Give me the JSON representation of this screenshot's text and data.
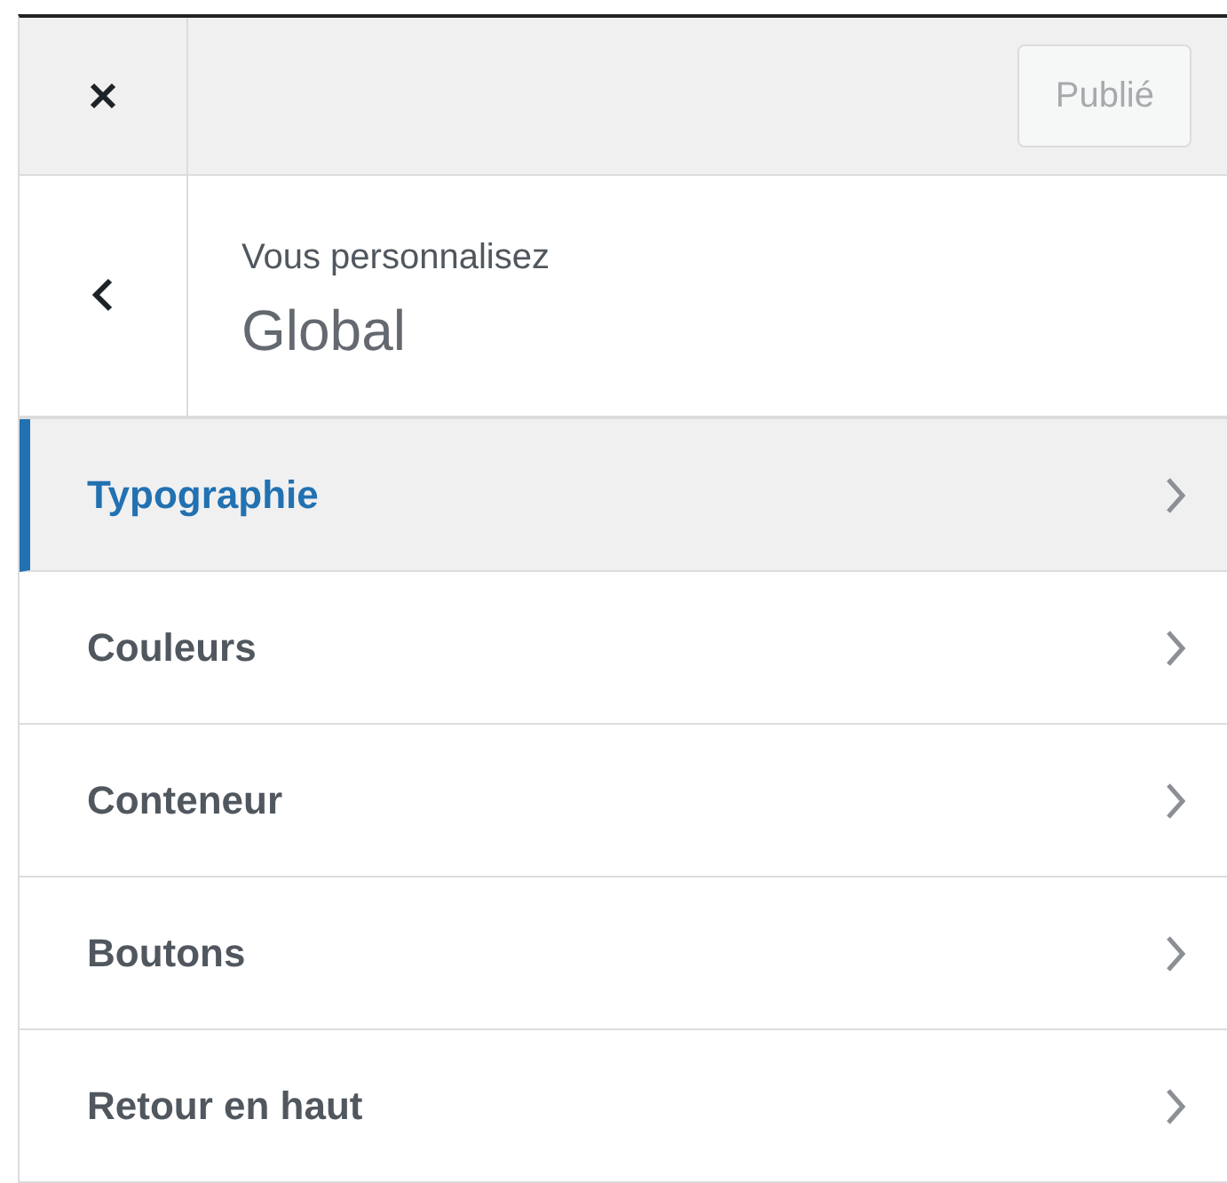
{
  "header": {
    "publish_button": {
      "label": "Publié",
      "disabled": true
    }
  },
  "title_section": {
    "subtitle": "Vous personnalisez",
    "title": "Global"
  },
  "menu_items": [
    {
      "label": "Typographie",
      "selected": true
    },
    {
      "label": "Couleurs",
      "selected": false
    },
    {
      "label": "Conteneur",
      "selected": false
    },
    {
      "label": "Boutons",
      "selected": false
    },
    {
      "label": "Retour en haut",
      "selected": false
    }
  ]
}
